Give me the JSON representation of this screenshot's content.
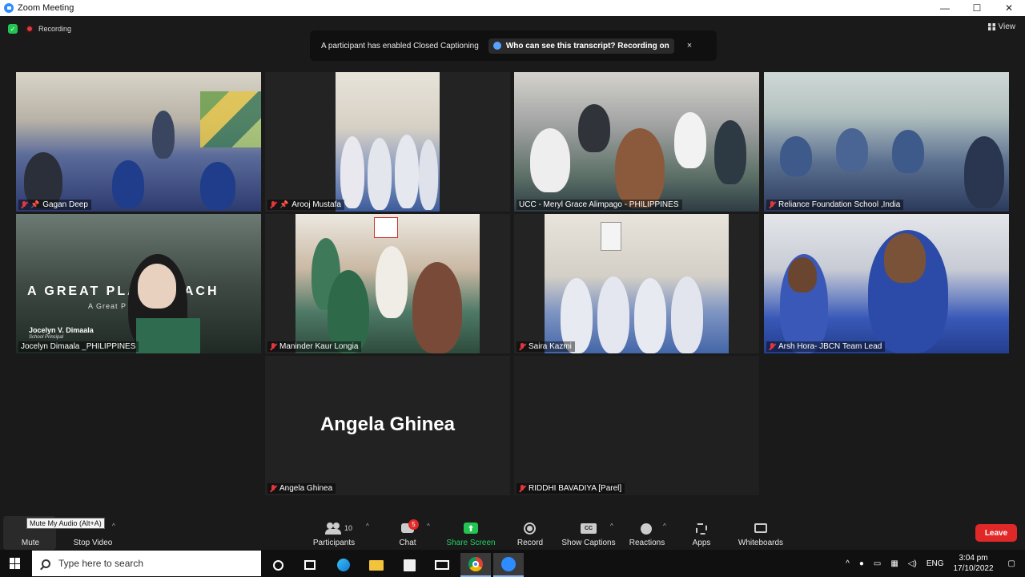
{
  "window": {
    "title": "Zoom Meeting",
    "controls": {
      "minimize": "—",
      "maximize": "☐",
      "close": "✕"
    }
  },
  "status": {
    "recording_label": "Recording",
    "view_label": "View"
  },
  "cc_banner": {
    "message": "A participant has enabled Closed Captioning",
    "action": "Who can see this transcript? Recording on",
    "close": "×"
  },
  "tiles": [
    {
      "name": "Gagan Deep",
      "pinned": true,
      "muted": true
    },
    {
      "name": "Arooj Mustafa",
      "pinned": true,
      "muted": true
    },
    {
      "name": "UCC - Meryl Grace Alimpago - PHILIPPINES",
      "active": true
    },
    {
      "name": "Reliance Foundation School ,India",
      "muted": true
    },
    {
      "name": "Jocelyn Dimaala _PHILIPPINES"
    },
    {
      "name": "Maninder Kaur Longia",
      "muted": true
    },
    {
      "name": "Saira Kazmi",
      "muted": true
    },
    {
      "name": "Arsh Hora- JBCN Team Lead",
      "muted": true
    },
    {
      "name": "Angela Ghinea",
      "muted": true,
      "avatar_text": "Angela Ghinea"
    },
    {
      "name": "RIDDHI BAVADIYA [Parel]",
      "muted": true
    }
  ],
  "virtual_background": {
    "headline": "A GREAT PLA    O TEACH",
    "subline": "A Great P           k",
    "person_name": "Jocelyn V. Dimaala",
    "person_role": "School Principal"
  },
  "toolbar": {
    "mute": "Mute",
    "mute_tooltip": "Mute My Audio (Alt+A)",
    "stop_video": "Stop Video",
    "participants": "Participants",
    "participants_count": "10",
    "chat": "Chat",
    "chat_badge": "5",
    "share_screen": "Share Screen",
    "record": "Record",
    "show_captions": "Show Captions",
    "reactions": "Reactions",
    "apps": "Apps",
    "whiteboards": "Whiteboards",
    "leave": "Leave"
  },
  "taskbar": {
    "search_placeholder": "Type here to search",
    "language": "ENG",
    "time": "3:04 pm",
    "date": "17/10/2022"
  },
  "colors": {
    "accent_blue": "#2d8cff",
    "leave_red": "#e02828",
    "active_speaker": "#e6ec77",
    "share_green": "#23d160"
  }
}
